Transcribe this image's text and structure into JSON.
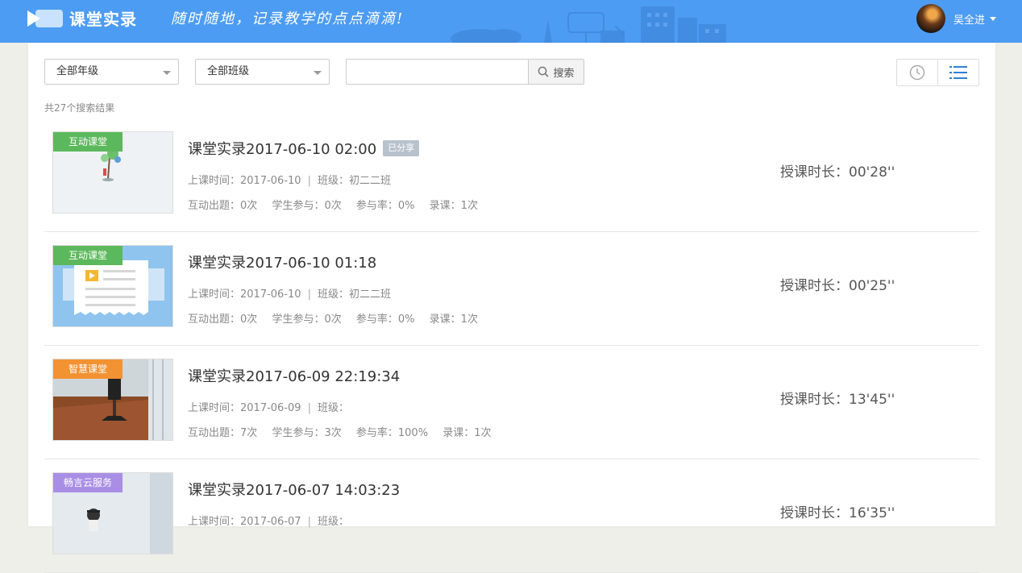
{
  "header": {
    "brand": "课堂实录",
    "slogan": "随时随地，记录教学的点点滴滴!",
    "username": "吴全进"
  },
  "filters": {
    "grade": "全部年级",
    "class": "全部班级",
    "search_placeholder": "",
    "search_label": "搜索"
  },
  "result_count": "共27个搜索结果",
  "labels": {
    "class_time_prefix": "上课时间：",
    "class_prefix": "班级：",
    "questions_prefix": "互动出题：",
    "participation_prefix": "学生参与：",
    "rate_prefix": "参与率：",
    "recording_prefix": "录课：",
    "duration_prefix": "授课时长：",
    "separator": "|"
  },
  "colors": {
    "header_bg": "#4d9cf3",
    "tag_green": "#5cb85c",
    "tag_orange": "#f39232",
    "tag_purple": "#a98ee6"
  },
  "records": [
    {
      "tag": "互动课堂",
      "title": "课堂实录2017-06-10 02:00",
      "shared_label": "已分享",
      "date": "2017-06-10",
      "class_name": "初二二班",
      "questions": "0次",
      "participation": "0次",
      "rate": "0%",
      "recording": "1次",
      "duration": "00'28''"
    },
    {
      "tag": "互动课堂",
      "title": "课堂实录2017-06-10 01:18",
      "shared_label": "",
      "date": "2017-06-10",
      "class_name": "初二二班",
      "questions": "0次",
      "participation": "0次",
      "rate": "0%",
      "recording": "1次",
      "duration": "00'25''"
    },
    {
      "tag": "智慧课堂",
      "title": "课堂实录2017-06-09 22:19:34",
      "shared_label": "",
      "date": "2017-06-09",
      "class_name": "",
      "questions": "7次",
      "participation": "3次",
      "rate": "100%",
      "recording": "1次",
      "duration": "13'45''"
    },
    {
      "tag": "畅言云服务",
      "title": "课堂实录2017-06-07 14:03:23",
      "shared_label": "",
      "date": "2017-06-07",
      "class_name": "",
      "questions": "",
      "participation": "",
      "rate": "",
      "recording": "",
      "duration": "16'35''"
    }
  ]
}
